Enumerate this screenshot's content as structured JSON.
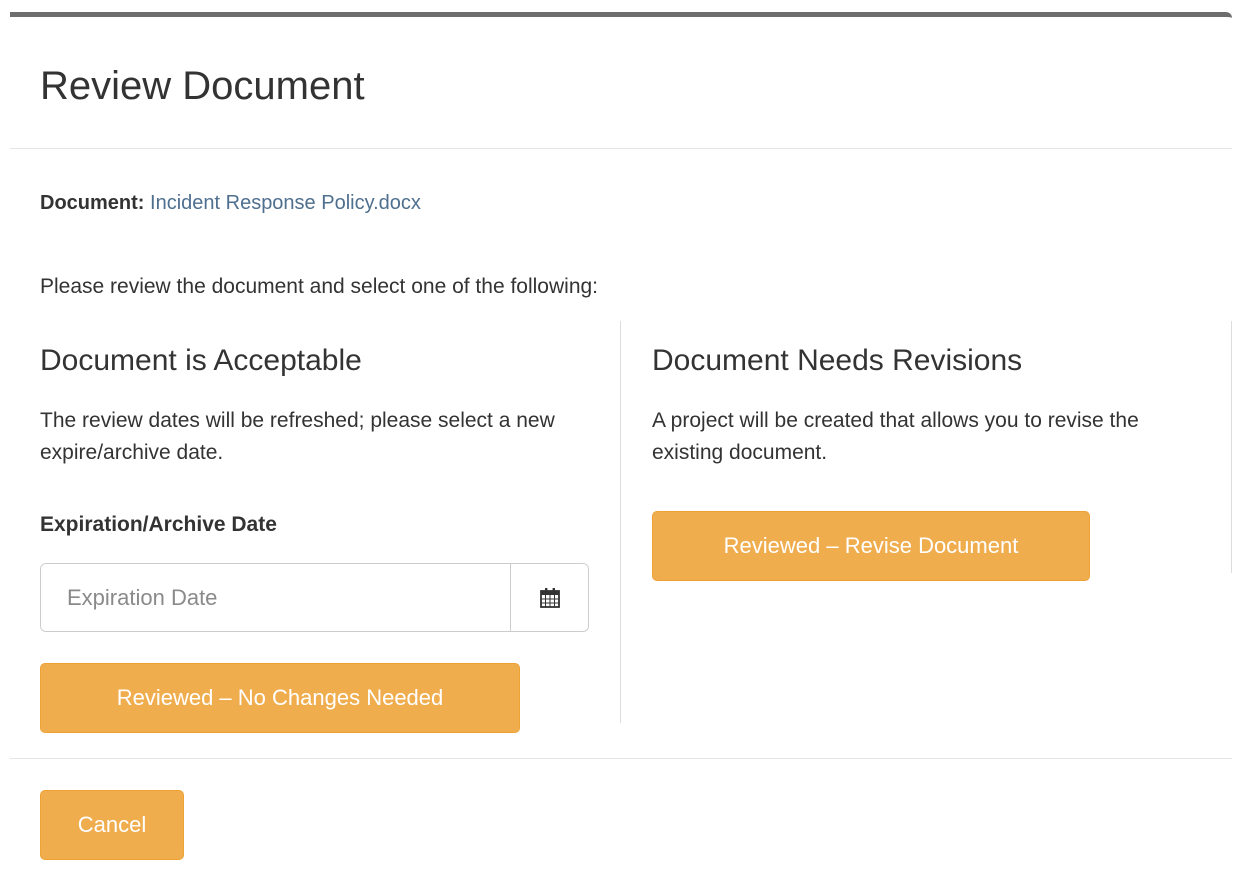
{
  "modal": {
    "title": "Review Document"
  },
  "document": {
    "label": "Document:",
    "name": "Incident Response Policy.docx"
  },
  "instructions": "Please review the document and select one of the following:",
  "acceptable": {
    "heading": "Document is Acceptable",
    "description": "The review dates will be refreshed; please select a new expire/archive date.",
    "field_label": "Expiration/Archive Date",
    "date_placeholder": "Expiration Date",
    "date_value": "",
    "addon_icon": "calendar-icon",
    "button_label": "Reviewed – No Changes Needed"
  },
  "revisions": {
    "heading": "Document Needs Revisions",
    "description": "A project will be created that allows you to revise the existing document.",
    "button_label": "Reviewed – Revise Document"
  },
  "footer": {
    "cancel_label": "Cancel"
  },
  "colors": {
    "warning_button": "#f0ad4e",
    "link": "#4f6f8f",
    "header_bar": "#6d6d6d"
  }
}
